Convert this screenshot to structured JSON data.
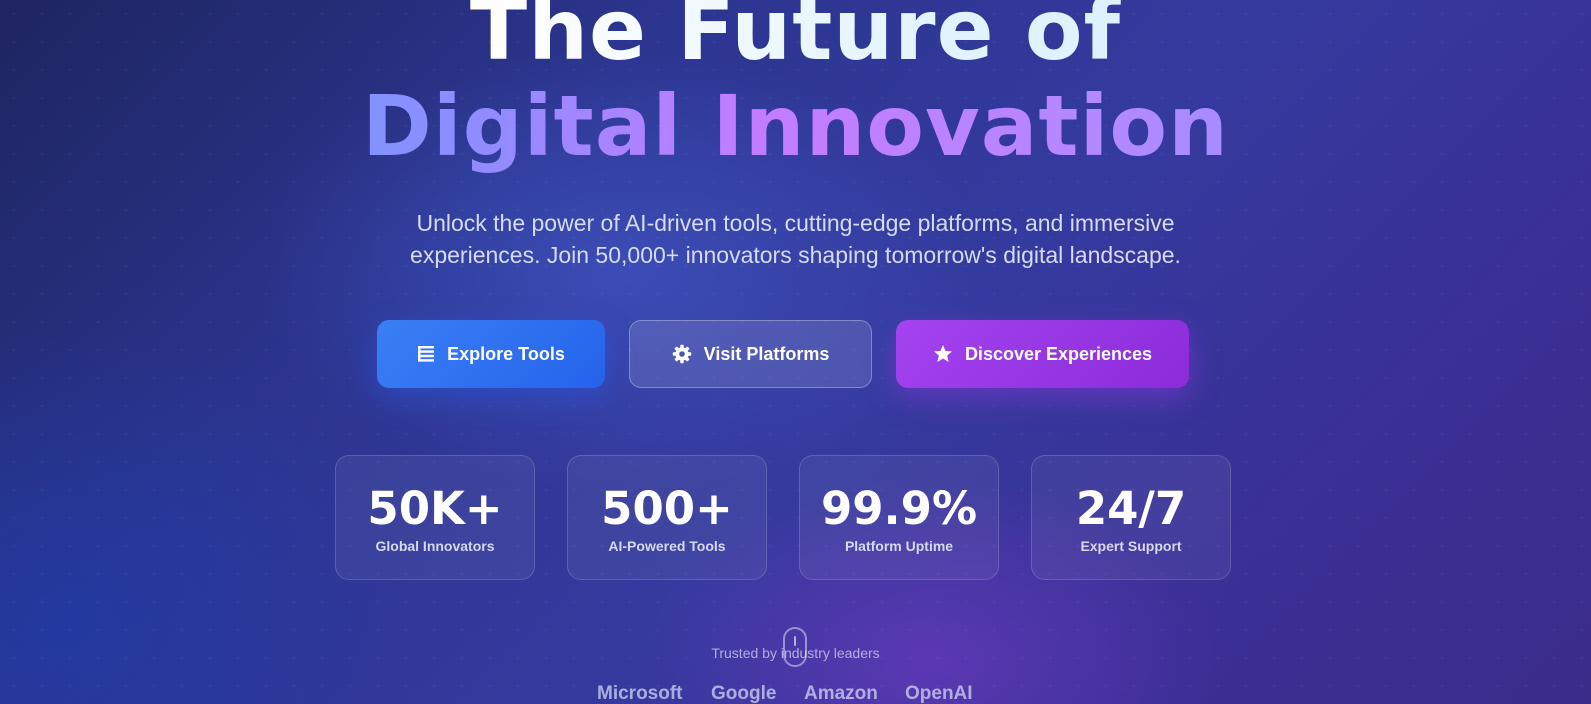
{
  "hero": {
    "title_line1": "The Future of",
    "title_line2": "Digital Innovation",
    "subtitle": "Unlock the power of AI-driven tools, cutting-edge platforms, and immersive experiences. Join 50,000+ innovators shaping tomorrow's digital landscape."
  },
  "actions": [
    {
      "label": "Explore Tools",
      "icon": "list-icon"
    },
    {
      "label": "Visit Platforms",
      "icon": "gear-icon"
    },
    {
      "label": "Discover Experiences",
      "icon": "star-icon"
    }
  ],
  "stats": [
    {
      "value": "50K+",
      "label": "Global Innovators"
    },
    {
      "value": "500+",
      "label": "AI-Powered Tools"
    },
    {
      "value": "99.9%",
      "label": "Platform Uptime"
    },
    {
      "value": "24/7",
      "label": "Expert Support"
    }
  ],
  "trust": {
    "heading": "Trusted by industry leaders",
    "partners": [
      "Microsoft",
      "Google",
      "Amazon",
      "OpenAI"
    ]
  },
  "colors": {
    "primary_blue": "#2563eb",
    "accent_purple": "#9333ea",
    "background_indigo": "#2c3590",
    "title_gradient_start": "#5aa8ff",
    "title_gradient_mid": "#c47cff"
  }
}
